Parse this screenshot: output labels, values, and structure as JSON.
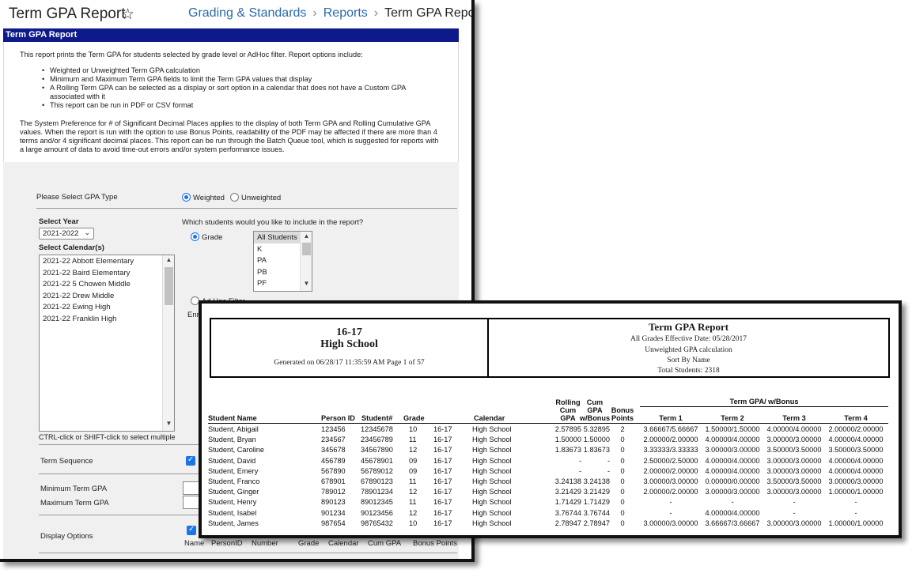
{
  "back": {
    "title": "Term GPA Report",
    "breadcrumb": [
      "Grading & Standards",
      "Reports",
      "Term GPA Report"
    ],
    "header_bar": "Term GPA Report",
    "desc_intro": "This report prints the Term GPA for students selected by grade level or AdHoc filter. Report options include:",
    "desc_bullets": [
      "Weighted or Unweighted Term GPA calculation",
      "Minimum and Maximum Term GPA fields to limit the Term GPA values that display",
      "A Rolling Term GPA can be selected as a display or sort option in a calendar that does not have a Custom GPA associated with it",
      "This report can be run in PDF or CSV format"
    ],
    "desc_note": "The System Preference for # of Significant Decimal Places applies to the display of both Term GPA and Rolling Cumulative GPA values. When the report is run with the option to use Bonus Points, readability of the PDF may be affected if there are more than 4 terms and/or 4 significant decimal places. This report can be run through the Batch Queue tool, which is suggested for reports with a large amount of data to avoid time-out errors and/or system performance issues.",
    "gpa_type_label": "Please Select GPA Type",
    "gpa_weighted": "Weighted",
    "gpa_unweighted": "Unweighted",
    "select_year_label": "Select Year",
    "year_value": "2021-2022",
    "select_calendars_label": "Select Calendar(s)",
    "calendars": [
      "2021-22 Abbott Elementary",
      "2021-22 Baird Elementary",
      "2021-22 5 Chowen Middle",
      "2021-22 Drew Middle",
      "2021-22 Ewing High",
      "2021-22 Franklin High"
    ],
    "ctrl_hint": "CTRL-click or SHIFT-click to select multiple",
    "which_students": "Which students would you like to include in the report?",
    "grade_label": "Grade",
    "grades": [
      "All Students",
      "K",
      "PA",
      "PB",
      "PF"
    ],
    "adhoc_label": "Ad Hoc Filter",
    "enr_label": "Enr",
    "term_sequence": "Term Sequence",
    "min_gpa": "Minimum Term GPA",
    "max_gpa": "Maximum Term GPA",
    "display_options": "Display Options",
    "display_cols": [
      "Name",
      "PersonID",
      "Number",
      "Grade",
      "Calendar",
      "Cum GPA",
      "Bonus Points"
    ]
  },
  "report": {
    "school_year": "16-17",
    "school": "High School",
    "generated": "Generated on 06/28/17 11:35:59 AM    Page 1 of  57",
    "title": "Term GPA Report",
    "grades_line": "All Grades    Effective Date: 05/28/2017",
    "calc_line": "Unweighted GPA calculation",
    "sort_line": "Sort By Name",
    "total_line": "Total Students: 2318",
    "headers": {
      "name": "Student Name",
      "person_id": "Person ID",
      "student_num": "Student#",
      "grade": "Grade",
      "calendar": "Calendar",
      "rolling": [
        "Rolling",
        "Cum",
        "GPA"
      ],
      "cum": [
        "Cum",
        "GPA",
        "w/Bonus"
      ],
      "bonus": [
        "Bonus",
        "Points"
      ],
      "term_group": "Term GPA/ w/Bonus",
      "terms": [
        "Term 1",
        "Term 2",
        "Term 3",
        "Term 4"
      ]
    },
    "rows": [
      {
        "name": "Student, Abigail",
        "pid": "123456",
        "snum": "12345678",
        "grade": "10",
        "yr": "16-17",
        "cal": "High School",
        "roll": "2.57895",
        "cum": "5.32895",
        "bonus": "2",
        "t1": "3.66667/5.66667",
        "t2": "1.50000/1.50000",
        "t3": "4.00000/4.00000",
        "t4": "2.00000/2.00000"
      },
      {
        "name": "Student, Bryan",
        "pid": "234567",
        "snum": "23456789",
        "grade": "11",
        "yr": "16-17",
        "cal": "High School",
        "roll": "1.50000",
        "cum": "1.50000",
        "bonus": "0",
        "t1": "2.00000/2.00000",
        "t2": "4.00000/4.00000",
        "t3": "3.00000/3.00000",
        "t4": "4.00000/4.00000"
      },
      {
        "name": "Student, Caroline",
        "pid": "345678",
        "snum": "34567890",
        "grade": "12",
        "yr": "16-17",
        "cal": "High School",
        "roll": "1.83673",
        "cum": "1.83673",
        "bonus": "0",
        "t1": "3.33333/3.33333",
        "t2": "3.00000/3.00000",
        "t3": "3.50000/3.50000",
        "t4": "3.50000/3.50000"
      },
      {
        "name": "Student, David",
        "pid": "456789",
        "snum": "45678901",
        "grade": "09",
        "yr": "16-17",
        "cal": "High School",
        "roll": "-",
        "cum": "-",
        "bonus": "0",
        "t1": "2.50000/2.50000",
        "t2": "4.00000/4.00000",
        "t3": "3.00000/3.00000",
        "t4": "4.00000/4.00000"
      },
      {
        "name": "Student, Emery",
        "pid": "567890",
        "snum": "56789012",
        "grade": "09",
        "yr": "16-17",
        "cal": "High School",
        "roll": "-",
        "cum": "-",
        "bonus": "0",
        "t1": "2.00000/2.00000",
        "t2": "4.00000/4.00000",
        "t3": "3.00000/3.00000",
        "t4": "4.00000/4.00000"
      },
      {
        "name": "Student, Franco",
        "pid": "678901",
        "snum": "67890123",
        "grade": "11",
        "yr": "16-17",
        "cal": "High School",
        "roll": "3.24138",
        "cum": "3.24138",
        "bonus": "0",
        "t1": "3.00000/3.00000",
        "t2": "0.00000/0.00000",
        "t3": "3.50000/3.50000",
        "t4": "3.00000/3.00000"
      },
      {
        "name": "Student, Ginger",
        "pid": "789012",
        "snum": "78901234",
        "grade": "12",
        "yr": "16-17",
        "cal": "High School",
        "roll": "3.21429",
        "cum": "3.21429",
        "bonus": "0",
        "t1": "2.00000/2.00000",
        "t2": "3.00000/3.00000",
        "t3": "3.00000/3.00000",
        "t4": "1.00000/1.00000"
      },
      {
        "name": "Student, Henry",
        "pid": "890123",
        "snum": "89012345",
        "grade": "11",
        "yr": "16-17",
        "cal": "High School",
        "roll": "1.71429",
        "cum": "1.71429",
        "bonus": "0",
        "t1": "-",
        "t2": "-",
        "t3": "-",
        "t4": "-"
      },
      {
        "name": "Student, Isabel",
        "pid": "901234",
        "snum": "90123456",
        "grade": "12",
        "yr": "16-17",
        "cal": "High School",
        "roll": "3.76744",
        "cum": "3.76744",
        "bonus": "0",
        "t1": "-",
        "t2": "4.00000/4.00000",
        "t3": "-",
        "t4": "-"
      },
      {
        "name": "Student, James",
        "pid": "987654",
        "snum": "98765432",
        "grade": "10",
        "yr": "16-17",
        "cal": "High School",
        "roll": "2.78947",
        "cum": "2.78947",
        "bonus": "0",
        "t1": "3.00000/3.00000",
        "t2": "3.66667/3.66667",
        "t3": "3.00000/3.00000",
        "t4": "1.00000/1.00000"
      }
    ]
  }
}
